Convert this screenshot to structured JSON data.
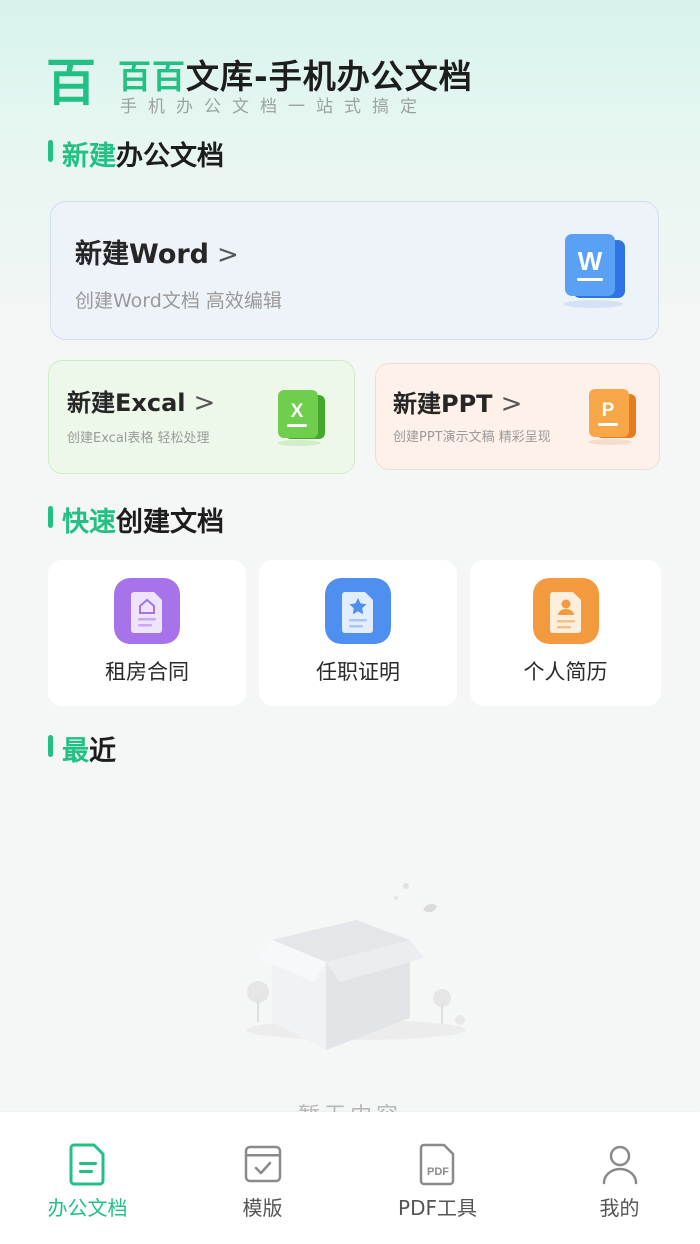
{
  "app": {
    "logo_char": "百",
    "title_accent": "百百",
    "title_rest": "文库-手机办公文档",
    "slogan": "手机办公文档一站式搞定"
  },
  "sections": {
    "new_docs": {
      "accent": "新建",
      "rest": "办公文档"
    },
    "quick": {
      "accent": "快速",
      "rest": "创建文档"
    },
    "recent": {
      "accent": "最",
      "rest": "近"
    }
  },
  "cards": {
    "word": {
      "title": "新建Word",
      "chevron": ">",
      "subtitle": "创建Word文档 高效编辑",
      "icon_letter": "W",
      "color": "#3f8cf0"
    },
    "excel": {
      "title": "新建Excal",
      "chevron": ">",
      "subtitle": "创建Excal表格 轻松处理",
      "icon_letter": "X",
      "color": "#5cc23e"
    },
    "ppt": {
      "title": "新建PPT",
      "chevron": ">",
      "subtitle": "创建PPT演示文稿 精彩呈现",
      "icon_letter": "P",
      "color": "#f29a3b"
    }
  },
  "quick_items": [
    {
      "label": "租房合同",
      "icon": "house-document-icon",
      "color": "#a673ea"
    },
    {
      "label": "任职证明",
      "icon": "star-document-icon",
      "color": "#4f8ff0"
    },
    {
      "label": "个人简历",
      "icon": "person-document-icon",
      "color": "#f49a3e"
    }
  ],
  "recent": {
    "empty_text": "暂无内容"
  },
  "tabs": [
    {
      "label": "办公文档",
      "icon": "document-icon",
      "active": true
    },
    {
      "label": "模版",
      "icon": "template-icon",
      "active": false
    },
    {
      "label": "PDF工具",
      "icon": "pdf-icon",
      "active": false,
      "icon_text": "PDF"
    },
    {
      "label": "我的",
      "icon": "user-icon",
      "active": false
    }
  ],
  "colors": {
    "accent": "#22c084"
  }
}
